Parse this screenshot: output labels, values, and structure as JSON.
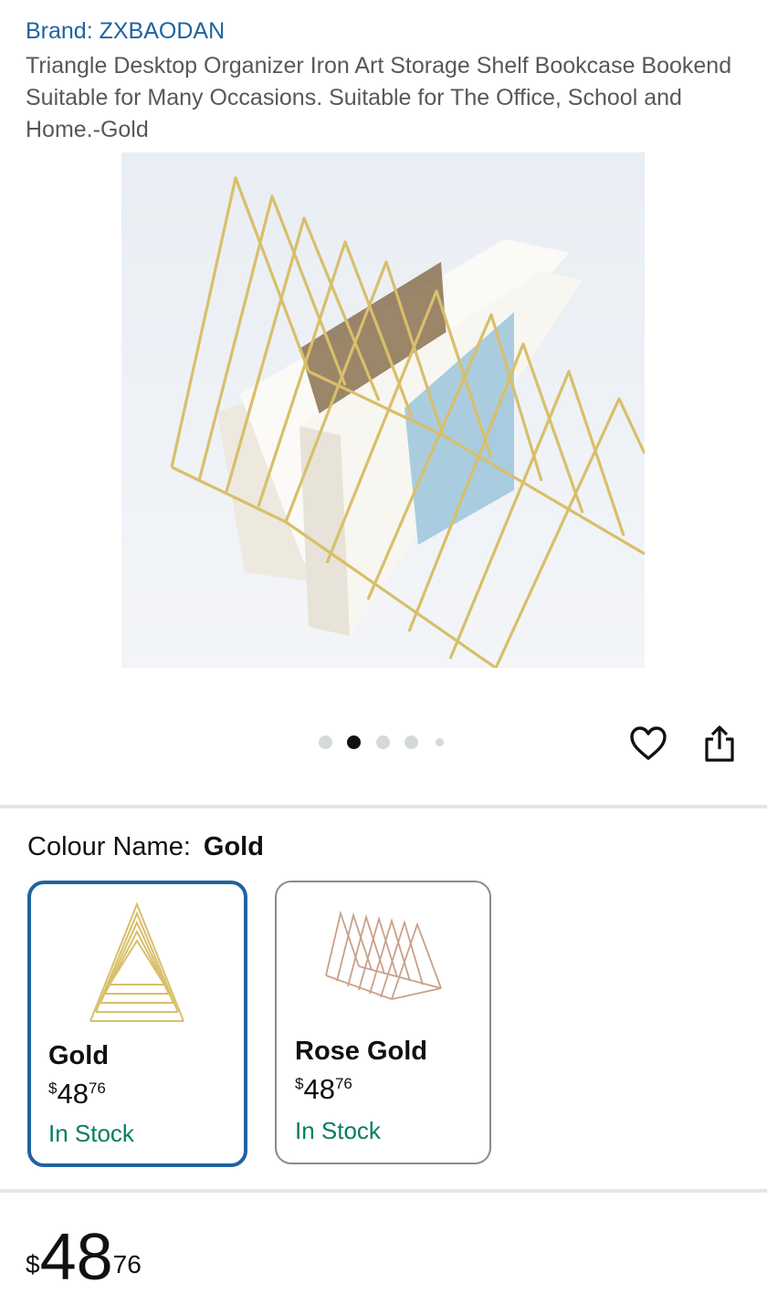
{
  "product": {
    "brand_link": "Brand: ZXBAODAN",
    "title": "Triangle Desktop Organizer Iron Art Storage Shelf Bookcase Bookend Suitable for Many Occasions. Suitable for The Office, School and Home.-Gold"
  },
  "gallery": {
    "image_count": 5,
    "active_index": 1
  },
  "actions": {
    "favorite_icon": "heart-outline-icon",
    "share_icon": "share-icon"
  },
  "variation": {
    "label": "Colour Name:",
    "selected_value": "Gold",
    "options": [
      {
        "name": "Gold",
        "price_symbol": "$",
        "price_whole": "48",
        "price_fraction": "76",
        "availability": "In Stock",
        "selected": true
      },
      {
        "name": "Rose Gold",
        "price_symbol": "$",
        "price_whole": "48",
        "price_fraction": "76",
        "availability": "In Stock",
        "selected": false
      }
    ]
  },
  "price": {
    "symbol": "$",
    "whole": "48",
    "fraction": "76"
  },
  "colors": {
    "link": "#2162a1",
    "in_stock": "#067d62",
    "selected_border": "#2162a1",
    "gold_wire": "#d8bf6a",
    "rose_gold_wire": "#c9a08a"
  }
}
